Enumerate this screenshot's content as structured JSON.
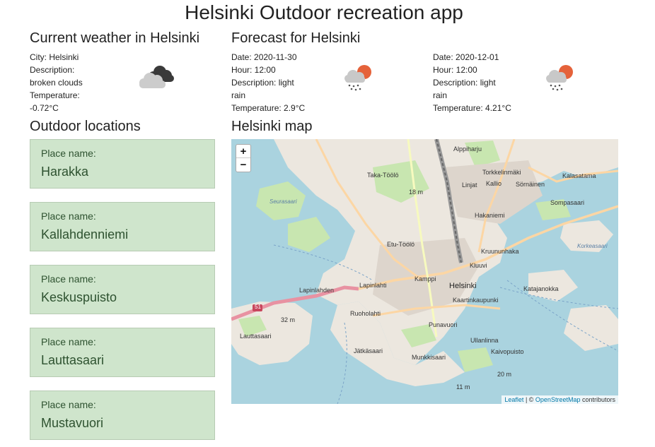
{
  "app": {
    "title": "Helsinki Outdoor recreation app"
  },
  "current": {
    "heading": "Current weather in Helsinki",
    "city": "City: Helsinki",
    "description_label": "Description:",
    "description": "broken clouds",
    "temperature_label": "Temperature:",
    "temperature": "-0.72°C",
    "icon": "broken-clouds-icon"
  },
  "forecast": {
    "heading": "Forecast for Helsinki",
    "items": [
      {
        "date": "Date: 2020-11-30",
        "hour": "Hour: 12:00",
        "description_1": "Description: light",
        "description_2": "rain",
        "temperature": "Temperature: 2.9°C",
        "icon": "light-rain-icon"
      },
      {
        "date": "Date: 2020-12-01",
        "hour": "Hour: 12:00",
        "description_1": "Description: light",
        "description_2": "rain",
        "temperature": "Temperature: 4.21°C",
        "icon": "light-rain-icon"
      }
    ]
  },
  "locations": {
    "heading": "Outdoor locations",
    "label": "Place name:",
    "places": [
      "Harakka",
      "Kallahdenniemi",
      "Keskuspuisto",
      "Lauttasaari",
      "Mustavuori"
    ]
  },
  "map": {
    "heading": "Helsinki map",
    "zoom_in": "+",
    "zoom_out": "−",
    "attribution_leaflet": "Leaflet",
    "attribution_sep": " | © ",
    "attribution_osm": "OpenStreetMap",
    "attribution_tail": " contributors",
    "labels": {
      "alppiharju": "Alppiharju",
      "taka_toolo": "Taka-Töölö",
      "torkkelinmaki": "Torkkelinmäki",
      "kalasatama": "Kalasatama",
      "linjat": "Linjat",
      "kallio": "Kallio",
      "sornainen": "Sörnäinen",
      "seurasaari": "Seurasaari",
      "hakaniemi": "Hakaniemi",
      "sompasaari": "Sompasaari",
      "etu_toolo": "Etu-Töölö",
      "kruununhaka": "Kruununhaka",
      "korkeasaari": "Korkeasaari",
      "kluuvi": "Kluuvi",
      "lapinlahti": "Lapinlahti",
      "kamppi": "Kamppi",
      "helsinki": "Helsinki",
      "katajanokka": "Katajanokka",
      "kaartinkaupunki": "Kaartinkaupunki",
      "ruoholahti": "Ruoholahti",
      "lauttasaari": "Lauttasaari",
      "punavuori": "Punavuori",
      "ullanlinna": "Ullanlinna",
      "jatkasaari": "Jätkäsaari",
      "kaivopuisto": "Kaivopuisto",
      "munkkisaari": "Munkkisaari",
      "lapinlahden_silta": "Lapinlahden",
      "road_51": "51",
      "m18": "18 m",
      "m32": "32 m",
      "m11": "11 m",
      "m20": "20 m"
    }
  }
}
